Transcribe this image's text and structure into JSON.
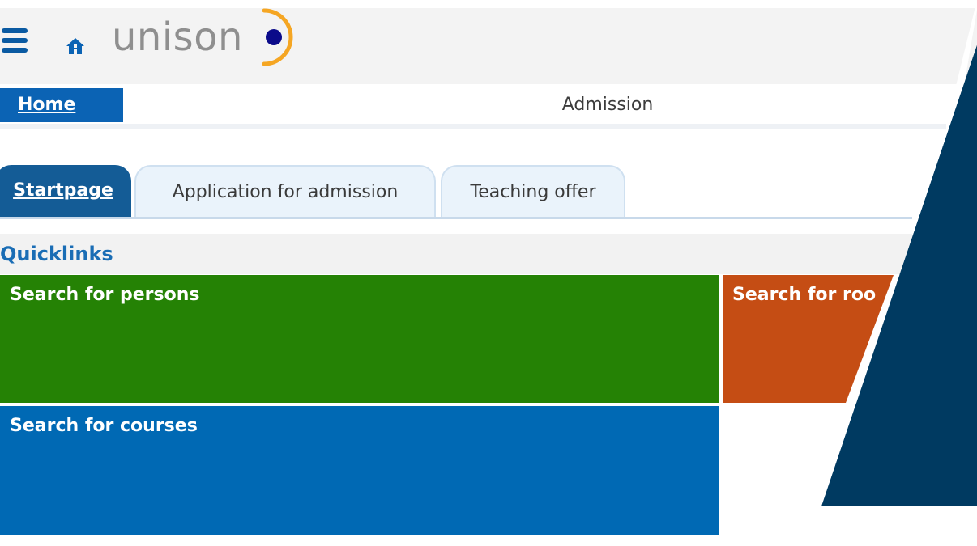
{
  "header": {
    "logo_text": "unison"
  },
  "breadcrumb": {
    "home_label": "Home",
    "page_title": "Admission"
  },
  "tabs": [
    {
      "label": "Startpage",
      "active": true
    },
    {
      "label": "Application for admission",
      "active": false
    },
    {
      "label": "Teaching offer",
      "active": false
    }
  ],
  "quicklinks": {
    "title": "Quicklinks",
    "tiles": [
      {
        "label": "Search for persons",
        "color": "#258205"
      },
      {
        "label": "Search for roo",
        "color": "#c54d14"
      },
      {
        "label": "Search for courses",
        "color": "#0069b4"
      }
    ]
  },
  "colors": {
    "brand_blue": "#0b63b4",
    "tab_active": "#145c96",
    "logo_orange": "#f5a623",
    "logo_dot": "#0b0b8a",
    "overlay_navy": "#003a61"
  },
  "icons": {
    "menu": "hamburger-icon",
    "home": "home-icon"
  }
}
